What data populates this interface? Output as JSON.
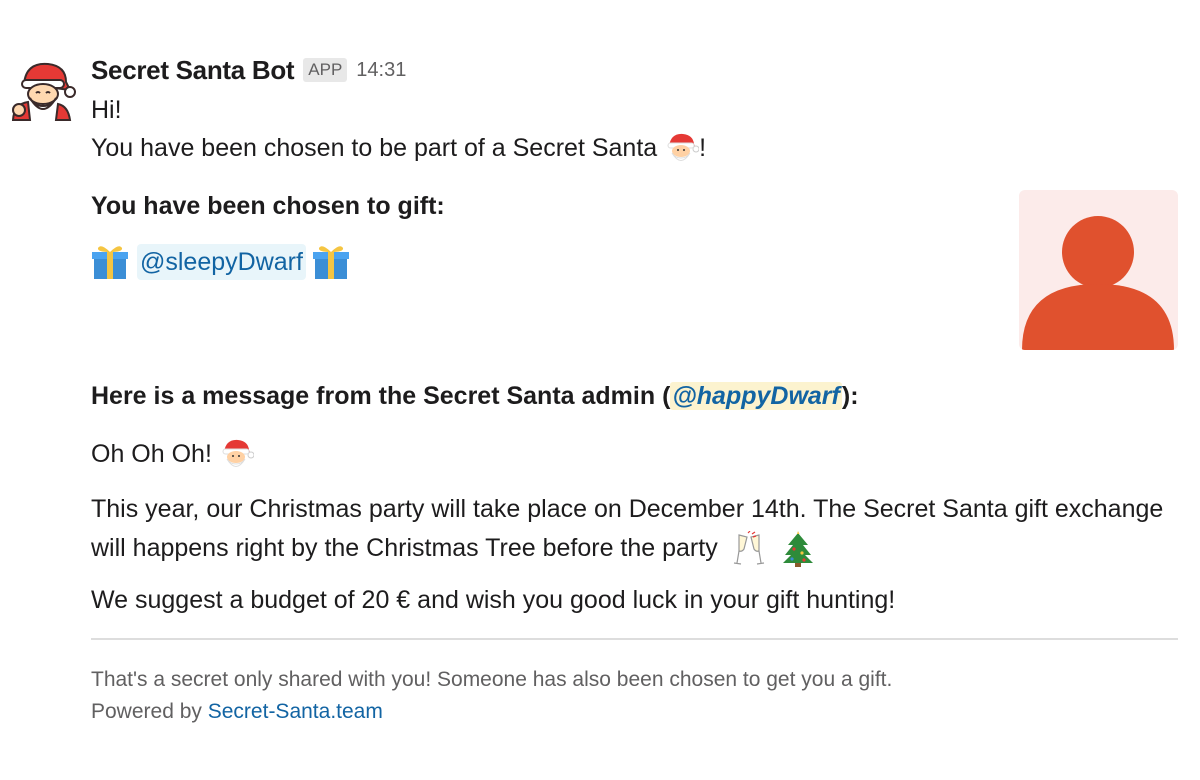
{
  "message": {
    "sender": "Secret Santa Bot",
    "badge": "APP",
    "timestamp": "14:31",
    "greeting": "Hi!",
    "chosen_text": "You have been chosen to be part of a Secret Santa",
    "chosen_suffix": "!",
    "gift_header": "You have been chosen to gift:",
    "recipient_mention": "@sleepyDwarf",
    "admin_header_prefix": "Here is a message from the Secret Santa admin (",
    "admin_mention": "@happyDwarf",
    "admin_header_suffix": "):",
    "admin_greeting": "Oh Oh Oh!",
    "paragraph_1": "This year, our Christmas party will take place on December 14th. The Secret Santa gift exchange will happens right by the Christmas Tree before the party",
    "paragraph_2": "We suggest a budget of 20 € and wish you good luck in your gift hunting!"
  },
  "footer": {
    "line_1": "That's a secret only shared with you! Someone has also been chosen to get you a gift.",
    "powered_prefix": "Powered by",
    "powered_link": "Secret-Santa.team"
  },
  "icons": {
    "avatar": "santa-avatar",
    "santa_emoji": "santa-icon",
    "gift_emoji": "gift-icon",
    "champagne_emoji": "champagne-icon",
    "tree_emoji": "christmas-tree-icon",
    "profile": "user-placeholder-icon"
  },
  "colors": {
    "text": "#1d1c1d",
    "muted": "#616061",
    "link": "#1264a3",
    "mention_bg": "#e8f5fa",
    "admin_mention_bg": "#fcf3cf",
    "profile_bg": "#fcebea",
    "profile_fg": "#e0512e"
  }
}
